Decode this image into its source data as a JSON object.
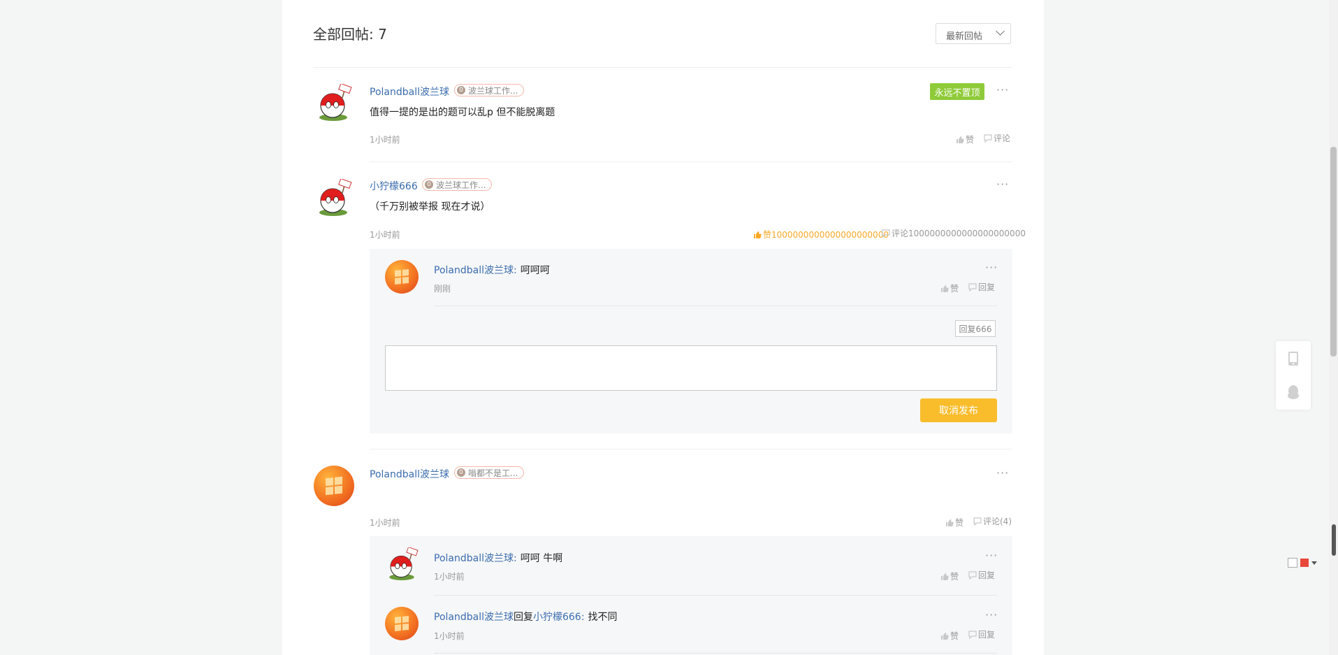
{
  "header": {
    "title": "全部回帖: 7",
    "sort_label": "最新回帖"
  },
  "posts": [
    {
      "username": "Polandball波兰球",
      "badge_level": "0",
      "badge_text": "波兰球工作...",
      "content": "值得一提的是出的题可以乱p 但不能脱离题",
      "time": "1小时前",
      "pin_label": "永远不置顶",
      "like_label": "赞",
      "comment_label": "评论"
    },
    {
      "username": "小狞檬666",
      "badge_level": "0",
      "badge_text": "波兰球工作...",
      "content": "（千万别被举报 现在才说）",
      "time": "1小时前",
      "like_label": "赞1000000000000000000000",
      "comment_label": "评论1000000000000000000000",
      "replies": [
        {
          "name": "Polandball波兰球",
          "sep": ":",
          "text": "呵呵呵",
          "time": "刚刚",
          "like_label": "赞",
          "reply_label": "回复"
        }
      ],
      "reply_to_label": "回复666",
      "publish_label": "取消发布"
    },
    {
      "username": "Polandball波兰球",
      "badge_level": "0",
      "badge_text": "嗡都不是工...",
      "content": "",
      "time": "1小时前",
      "like_label": "赞",
      "comment_label": "评论(4)",
      "replies": [
        {
          "name": "Polandball波兰球",
          "sep": ":",
          "text": "呵呵 牛啊",
          "time": "1小时前",
          "like_label": "赞",
          "reply_label": "回复"
        },
        {
          "name": "Polandball波兰球",
          "mid": "回复",
          "target": "小狞檬666",
          "sep": ":",
          "text": "找不同",
          "time": "1小时前",
          "like_label": "赞",
          "reply_label": "回复"
        }
      ]
    }
  ],
  "more_glyph": "···",
  "colors": {
    "link": "#3a6cae",
    "pin": "#8fcb39",
    "publish": "#f9bd2c",
    "liked": "#f9a825"
  },
  "icons": [
    "thumb-up-icon",
    "comment-icon",
    "more-icon",
    "phone-icon",
    "qq-penguin-icon",
    "chevron-down-icon"
  ]
}
